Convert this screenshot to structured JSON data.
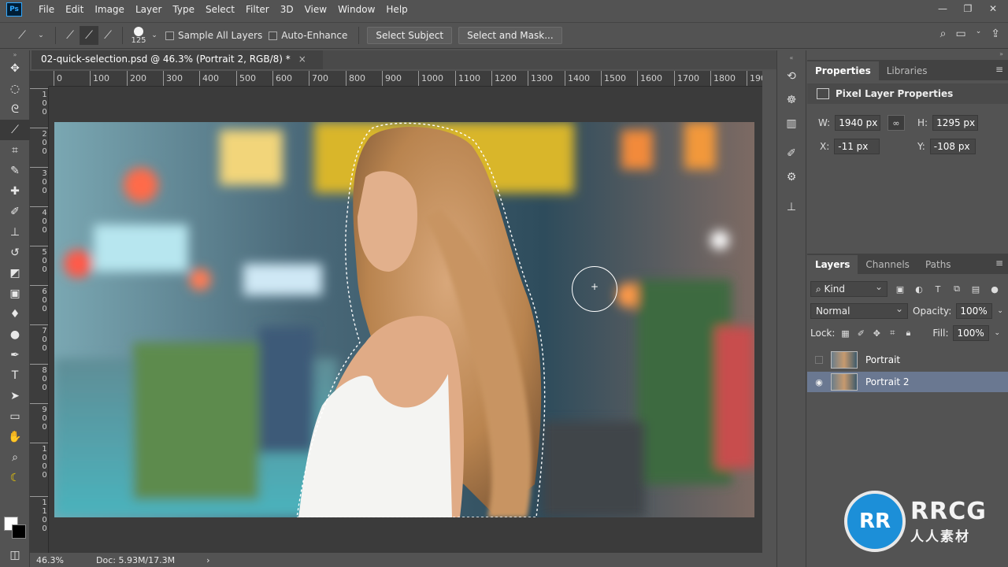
{
  "app": {
    "logo_text": "Ps",
    "menu": [
      "File",
      "Edit",
      "Image",
      "Layer",
      "Type",
      "Select",
      "Filter",
      "3D",
      "View",
      "Window",
      "Help"
    ],
    "window_controls": [
      "—",
      "❐",
      "✕"
    ]
  },
  "options_bar": {
    "brush_size": "125",
    "sample_all_layers": "Sample All Layers",
    "auto_enhance": "Auto-Enhance",
    "select_subject": "Select Subject",
    "select_and_mask": "Select and Mask..."
  },
  "document": {
    "tab_title": "02-quick-selection.psd @ 46.3% (Portrait 2, RGB/8) *",
    "close": "×"
  },
  "ruler": {
    "horizontal": [
      "0",
      "100",
      "200",
      "300",
      "400",
      "500",
      "600",
      "700",
      "800",
      "900",
      "1000",
      "1100",
      "1200",
      "1300",
      "1400",
      "1500",
      "1600",
      "1700",
      "1800",
      "190"
    ],
    "vertical": [
      "100",
      "200",
      "300",
      "400",
      "500",
      "600",
      "700",
      "800",
      "900",
      "1000",
      "1100"
    ]
  },
  "status_bar": {
    "zoom": "46.3%",
    "doc": "Doc: 5.93M/17.3M",
    "arrow": "›"
  },
  "properties": {
    "tabs": [
      "Properties",
      "Libraries"
    ],
    "header": "Pixel Layer Properties",
    "w_label": "W:",
    "w_value": "1940 px",
    "h_label": "H:",
    "h_value": "1295 px",
    "x_label": "X:",
    "x_value": "-11 px",
    "y_label": "Y:",
    "y_value": "-108 px",
    "link_icon": "∞"
  },
  "layers": {
    "tabs": [
      "Layers",
      "Channels",
      "Paths"
    ],
    "kind": "Kind",
    "blend_mode": "Normal",
    "opacity_label": "Opacity:",
    "opacity_value": "100%",
    "lock_label": "Lock:",
    "fill_label": "Fill:",
    "fill_value": "100%",
    "items": [
      {
        "name": "Portrait",
        "visible": false,
        "selected": false
      },
      {
        "name": "Portrait 2",
        "visible": true,
        "selected": true
      }
    ]
  },
  "watermark": {
    "logo_big": "RRCG",
    "logo_small": "人人素材",
    "circle_text": "RR"
  },
  "colors": {
    "ui_bg": "#535353",
    "selected_layer": "#6a7891",
    "brand_blue": "#1c8fd8"
  }
}
